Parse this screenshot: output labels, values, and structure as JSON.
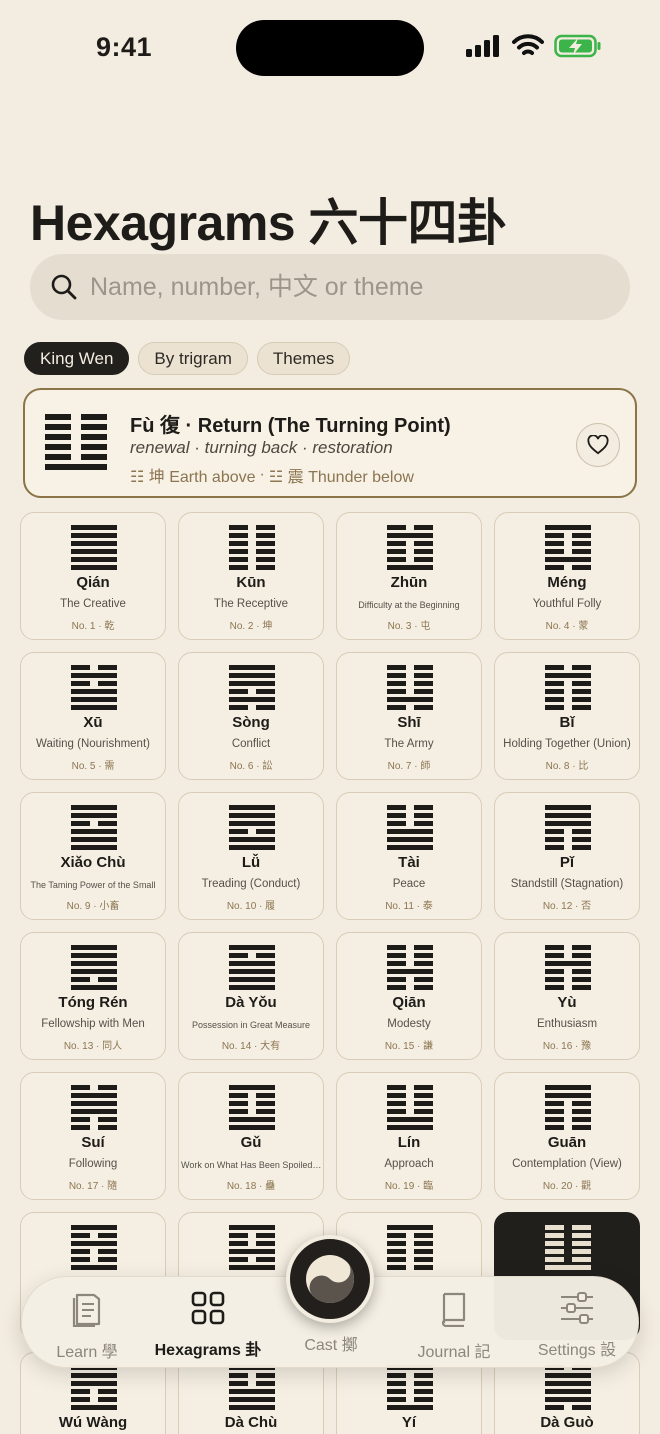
{
  "status": {
    "time": "9:41"
  },
  "title": "Hexagrams 六十四卦",
  "search": {
    "placeholder": "Name, number, 中文 or theme"
  },
  "filters": [
    "King Wen",
    "By trigram",
    "Themes"
  ],
  "featured": {
    "title": "Fù 復 · Return (The Turning Point)",
    "keywords": "renewal · turning back · restoration",
    "upper": "☷ 坤 Earth above",
    "separator": "·",
    "lower": "☳ 震 Thunder below",
    "lines": [
      0,
      0,
      0,
      0,
      0,
      1
    ]
  },
  "hexagrams": [
    {
      "name": "Qián",
      "en": "The Creative",
      "num": "No. 1 · 乾",
      "lines": [
        1,
        1,
        1,
        1,
        1,
        1
      ]
    },
    {
      "name": "Kūn",
      "en": "The Receptive",
      "num": "No. 2 · 坤",
      "lines": [
        0,
        0,
        0,
        0,
        0,
        0
      ]
    },
    {
      "name": "Zhūn",
      "en": "Difficulty at the Beginning",
      "num": "No. 3 · 屯",
      "lines": [
        0,
        1,
        0,
        0,
        0,
        1
      ]
    },
    {
      "name": "Méng",
      "en": "Youthful Folly",
      "num": "No. 4 · 蒙",
      "lines": [
        1,
        0,
        0,
        0,
        1,
        0
      ]
    },
    {
      "name": "Xū",
      "en": "Waiting (Nourishment)",
      "num": "No. 5 · 需",
      "lines": [
        0,
        1,
        0,
        1,
        1,
        1
      ]
    },
    {
      "name": "Sòng",
      "en": "Conflict",
      "num": "No. 6 · 訟",
      "lines": [
        1,
        1,
        1,
        0,
        1,
        0
      ]
    },
    {
      "name": "Shī",
      "en": "The Army",
      "num": "No. 7 · 師",
      "lines": [
        0,
        0,
        0,
        0,
        1,
        0
      ]
    },
    {
      "name": "Bǐ",
      "en": "Holding Together (Union)",
      "num": "No. 8 · 比",
      "lines": [
        0,
        1,
        0,
        0,
        0,
        0
      ]
    },
    {
      "name": "Xiǎo Chù",
      "en": "The Taming Power of the Small",
      "num": "No. 9 · 小畜",
      "lines": [
        1,
        1,
        0,
        1,
        1,
        1
      ]
    },
    {
      "name": "Lǚ",
      "en": "Treading (Conduct)",
      "num": "No. 10 · 履",
      "lines": [
        1,
        1,
        1,
        0,
        1,
        1
      ]
    },
    {
      "name": "Tài",
      "en": "Peace",
      "num": "No. 11 · 泰",
      "lines": [
        0,
        0,
        0,
        1,
        1,
        1
      ]
    },
    {
      "name": "Pǐ",
      "en": "Standstill (Stagnation)",
      "num": "No. 12 · 否",
      "lines": [
        1,
        1,
        1,
        0,
        0,
        0
      ]
    },
    {
      "name": "Tóng Rén",
      "en": "Fellowship with Men",
      "num": "No. 13 · 同人",
      "lines": [
        1,
        1,
        1,
        1,
        0,
        1
      ]
    },
    {
      "name": "Dà Yǒu",
      "en": "Possession in Great Measure",
      "num": "No. 14 · 大有",
      "lines": [
        1,
        0,
        1,
        1,
        1,
        1
      ]
    },
    {
      "name": "Qiān",
      "en": "Modesty",
      "num": "No. 15 · 謙",
      "lines": [
        0,
        0,
        0,
        1,
        0,
        0
      ]
    },
    {
      "name": "Yù",
      "en": "Enthusiasm",
      "num": "No. 16 · 豫",
      "lines": [
        0,
        0,
        1,
        0,
        0,
        0
      ]
    },
    {
      "name": "Suí",
      "en": "Following",
      "num": "No. 17 · 隨",
      "lines": [
        0,
        1,
        1,
        1,
        0,
        0
      ]
    },
    {
      "name": "Gǔ",
      "en": "Work on What Has Been Spoiled…",
      "num": "No. 18 · 蠱",
      "lines": [
        1,
        0,
        0,
        0,
        1,
        1
      ]
    },
    {
      "name": "Lín",
      "en": "Approach",
      "num": "No. 19 · 臨",
      "lines": [
        0,
        0,
        0,
        0,
        1,
        1
      ]
    },
    {
      "name": "Guān",
      "en": "Contemplation (View)",
      "num": "No. 20 · 觀",
      "lines": [
        1,
        1,
        0,
        0,
        0,
        0
      ]
    },
    {
      "name": "",
      "en": "",
      "num": "",
      "lines": [
        1,
        0,
        1,
        0,
        0,
        1
      ]
    },
    {
      "name": "",
      "en": "",
      "num": "",
      "lines": [
        1,
        0,
        0,
        1,
        0,
        1
      ]
    },
    {
      "name": "",
      "en": "",
      "num": "",
      "lines": [
        1,
        0,
        0,
        0,
        0,
        0
      ]
    },
    {
      "name": "",
      "en": "",
      "num": "",
      "lines": [
        0,
        0,
        0,
        0,
        0,
        1
      ],
      "selected": true
    },
    {
      "name": "Wú Wàng",
      "en": "",
      "num": "",
      "lines": [
        1,
        1,
        1,
        0,
        0,
        1
      ]
    },
    {
      "name": "Dà Chù",
      "en": "",
      "num": "",
      "lines": [
        1,
        0,
        0,
        1,
        1,
        1
      ]
    },
    {
      "name": "Yí",
      "en": "",
      "num": "",
      "lines": [
        1,
        0,
        0,
        0,
        0,
        1
      ]
    },
    {
      "name": "Dà Guò",
      "en": "",
      "num": "",
      "lines": [
        0,
        1,
        1,
        1,
        1,
        0
      ]
    }
  ],
  "tabs": {
    "learn": "Learn 學",
    "hexagrams": "Hexagrams 卦",
    "cast": "Cast 擲",
    "journal": "Journal 記",
    "settings": "Settings 設"
  }
}
